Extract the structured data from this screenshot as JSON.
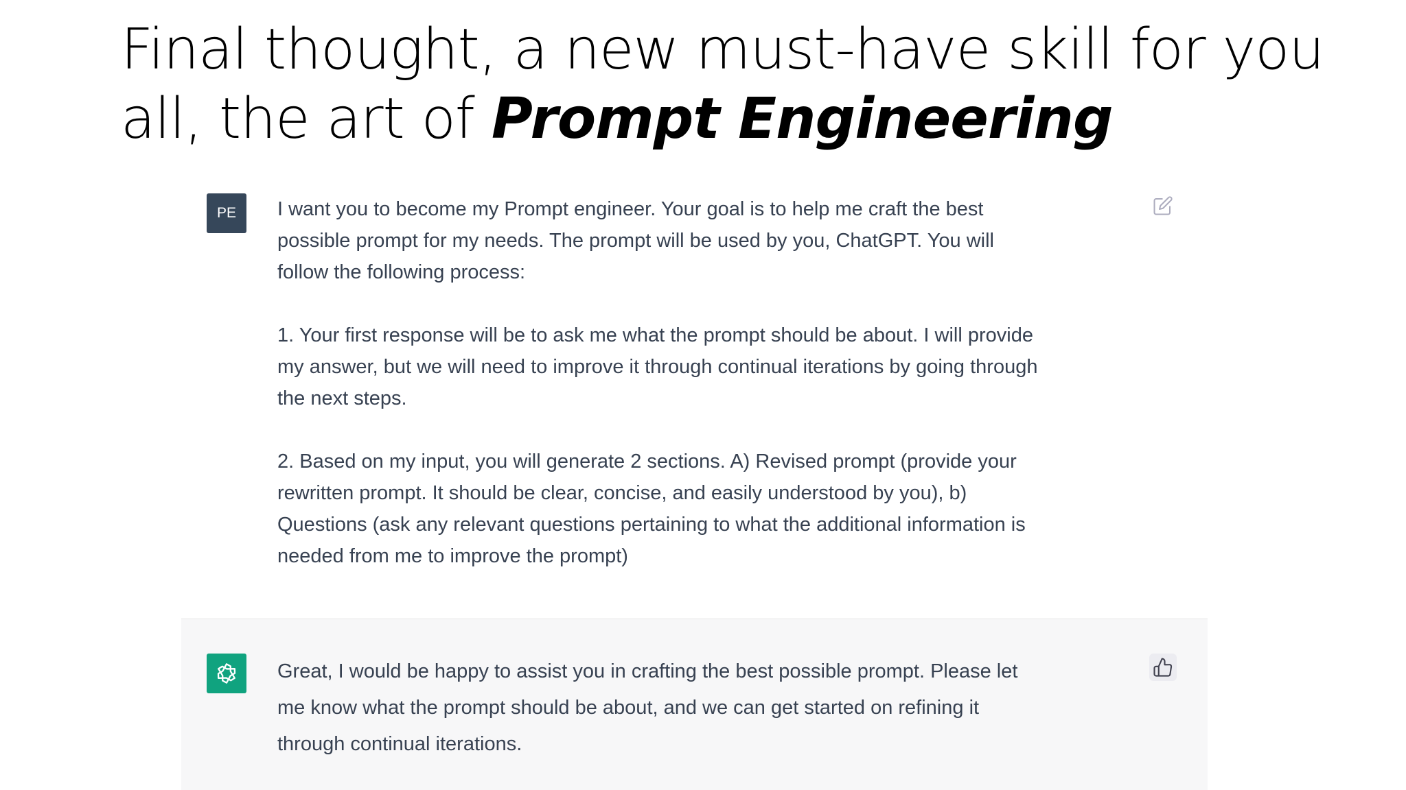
{
  "slide": {
    "title_part1": "Final thought, a new must-have skill for you all, the art of ",
    "title_emphasis": "Prompt Engineering"
  },
  "chat": {
    "user_message": {
      "avatar_initials": "PE",
      "paragraphs": [
        "I want you to become my Prompt engineer. Your goal is to help me craft the best possible prompt for my needs. The prompt will be used by you, ChatGPT. You will follow the following process:",
        "1. Your first response will be to ask me what the prompt should be about. I will provide my answer, but we will need to improve it through continual iterations by going through the next steps.",
        "2. Based on my input, you will generate 2 sections. A) Revised prompt (provide your rewritten prompt. It should be clear, concise, and easily understood by you), b) Questions (ask any relevant questions pertaining to what the additional information is needed from me to improve the prompt)"
      ],
      "action_icon": "edit-icon"
    },
    "assistant_message": {
      "avatar_icon": "openai-logo-icon",
      "text": "Great, I would be happy to assist you in crafting the best possible prompt. Please let me know what the prompt should be about, and we can get started on refining it through continual iterations.",
      "action_icon": "thumbs-up-icon"
    }
  },
  "colors": {
    "user_avatar_bg": "#36475a",
    "assistant_avatar_bg": "#10a37f",
    "assistant_row_bg": "#f7f7f8",
    "message_text": "#374151"
  }
}
